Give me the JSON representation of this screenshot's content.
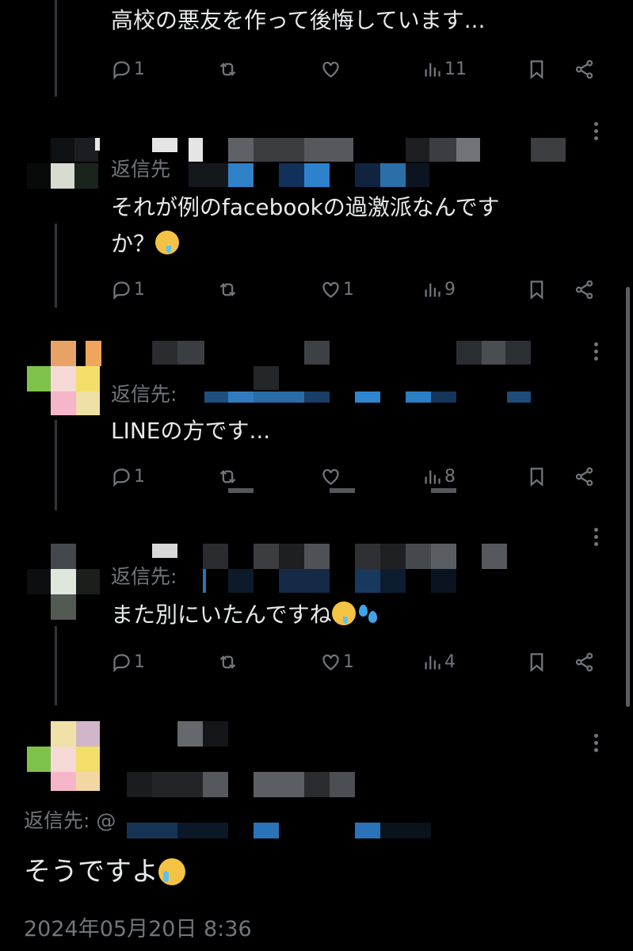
{
  "colors": {
    "background": "#000000",
    "text": "#e7e9ea",
    "muted": "#71767b",
    "link": "#1d9bf0"
  },
  "tweets": [
    {
      "text": "高校の悪友を作って後悔しています...",
      "replies": "1",
      "retweets": "",
      "likes": "",
      "views": "11"
    },
    {
      "reply_label": "返信先",
      "text_line1": "それが例のfacebookの過激派なんです",
      "text_line2": "か？",
      "replies": "1",
      "retweets": "",
      "likes": "1",
      "views": "9"
    },
    {
      "reply_label": "返信先:",
      "text": "LINEの方です...",
      "replies": "1",
      "retweets": "",
      "likes": "",
      "views": "8"
    },
    {
      "reply_label": "返信先:",
      "text": "また別にいたんですね",
      "replies": "1",
      "retweets": "",
      "likes": "1",
      "views": "4"
    }
  ],
  "main_tweet": {
    "reply_label": "返信先: @",
    "text": "そうですよ",
    "timestamp": "2024年05月20日 8:36"
  },
  "icons": [
    "reply-icon",
    "retweet-icon",
    "like-icon",
    "views-icon",
    "bookmark-icon",
    "share-icon",
    "more-icon"
  ]
}
